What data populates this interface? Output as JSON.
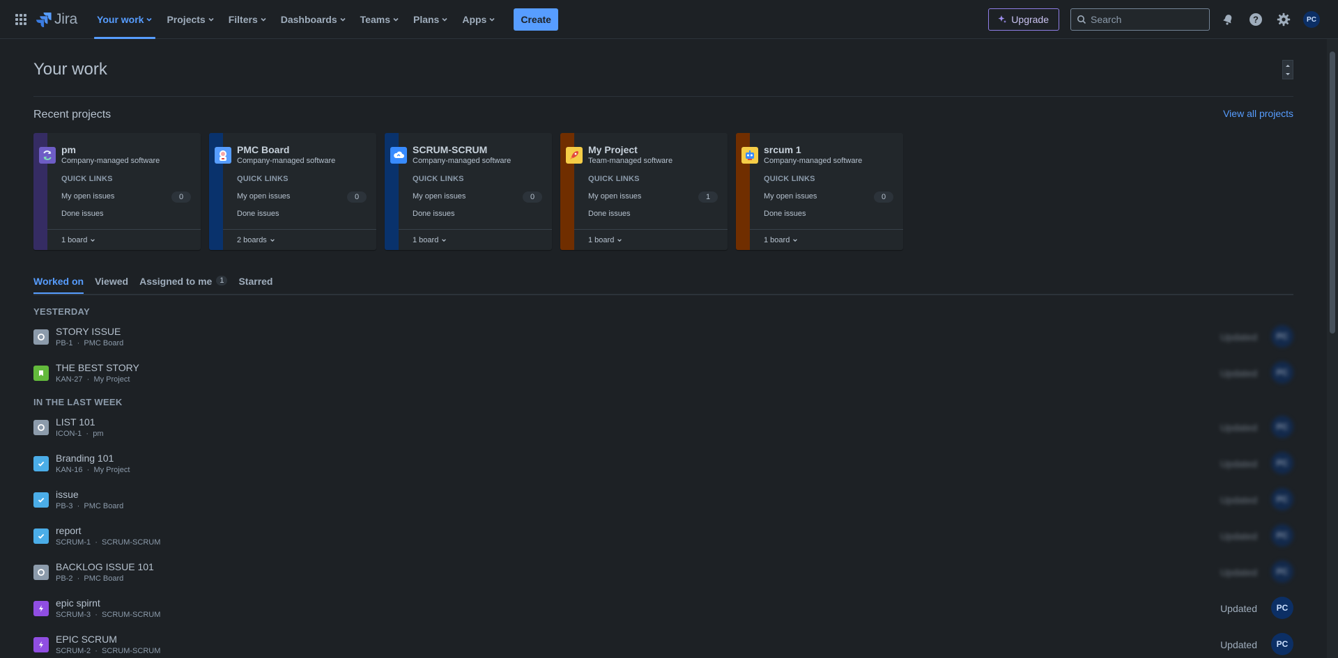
{
  "nav": {
    "logo": "Jira",
    "items": [
      "Your work",
      "Projects",
      "Filters",
      "Dashboards",
      "Teams",
      "Plans",
      "Apps"
    ],
    "create_label": "Create",
    "upgrade_label": "Upgrade",
    "search_placeholder": "Search",
    "avatar_initials": "PC",
    "accent_color": "#579dff"
  },
  "page": {
    "title": "Your work",
    "recent_projects_heading": "Recent projects",
    "view_all_label": "View all projects"
  },
  "projects": [
    {
      "name": "pm",
      "type": "Company-managed software",
      "quick_links": "QUICK LINKS",
      "open_issues_label": "My open issues",
      "open_count": "0",
      "done_label": "Done issues",
      "boards": "1 board",
      "band_color": "#352c63",
      "icon": "sync-icon"
    },
    {
      "name": "PMC Board",
      "type": "Company-managed software",
      "quick_links": "QUICK LINKS",
      "open_issues_label": "My open issues",
      "open_count": "0",
      "done_label": "Done issues",
      "boards": "2 boards",
      "band_color": "#09326c",
      "icon": "astronaut-icon"
    },
    {
      "name": "SCRUM-SCRUM",
      "type": "Company-managed software",
      "quick_links": "QUICK LINKS",
      "open_issues_label": "My open issues",
      "open_count": "0",
      "done_label": "Done issues",
      "boards": "1 board",
      "band_color": "#09326c",
      "icon": "cloud-icon"
    },
    {
      "name": "My Project",
      "type": "Team-managed software",
      "quick_links": "QUICK LINKS",
      "open_issues_label": "My open issues",
      "open_count": "1",
      "done_label": "Done issues",
      "boards": "1 board",
      "band_color": "#702e00",
      "icon": "rocket-icon"
    },
    {
      "name": "srcum 1",
      "type": "Company-managed software",
      "quick_links": "QUICK LINKS",
      "open_issues_label": "My open issues",
      "open_count": "0",
      "done_label": "Done issues",
      "boards": "1 board",
      "band_color": "#702e00",
      "icon": "robot-icon"
    }
  ],
  "tabs": [
    {
      "label": "Worked on",
      "active": true
    },
    {
      "label": "Viewed"
    },
    {
      "label": "Assigned to me",
      "badge": "1"
    },
    {
      "label": "Starred"
    }
  ],
  "groups": [
    {
      "label": "YESTERDAY",
      "items": [
        {
          "title": "STORY ISSUE",
          "key": "PB-1",
          "project": "PMC Board",
          "type": "subtask-icon"
        },
        {
          "title": "THE BEST STORY",
          "key": "KAN-27",
          "project": "My Project",
          "type": "story-icon"
        }
      ]
    },
    {
      "label": "IN THE LAST WEEK",
      "items": [
        {
          "title": "LIST 101",
          "key": "ICON-1",
          "project": "pm",
          "type": "subtask-icon"
        },
        {
          "title": "Branding 101",
          "key": "KAN-16",
          "project": "My Project",
          "type": "task-icon"
        },
        {
          "title": "issue",
          "key": "PB-3",
          "project": "PMC Board",
          "type": "task-icon"
        },
        {
          "title": "report",
          "key": "SCRUM-1",
          "project": "SCRUM-SCRUM",
          "type": "task-icon"
        },
        {
          "title": "BACKLOG ISSUE 101",
          "key": "PB-2",
          "project": "PMC Board",
          "type": "subtask-icon"
        },
        {
          "title": "epic spirnt",
          "key": "SCRUM-3",
          "project": "SCRUM-SCRUM",
          "type": "epic-icon",
          "updated": "Updated"
        },
        {
          "title": "EPIC SCRUM",
          "key": "SCRUM-2",
          "project": "SCRUM-SCRUM",
          "type": "epic-icon",
          "updated": "Updated"
        }
      ]
    }
  ],
  "updated_label": "Updated",
  "assignee_initials": "PC",
  "meta_separator": "·"
}
